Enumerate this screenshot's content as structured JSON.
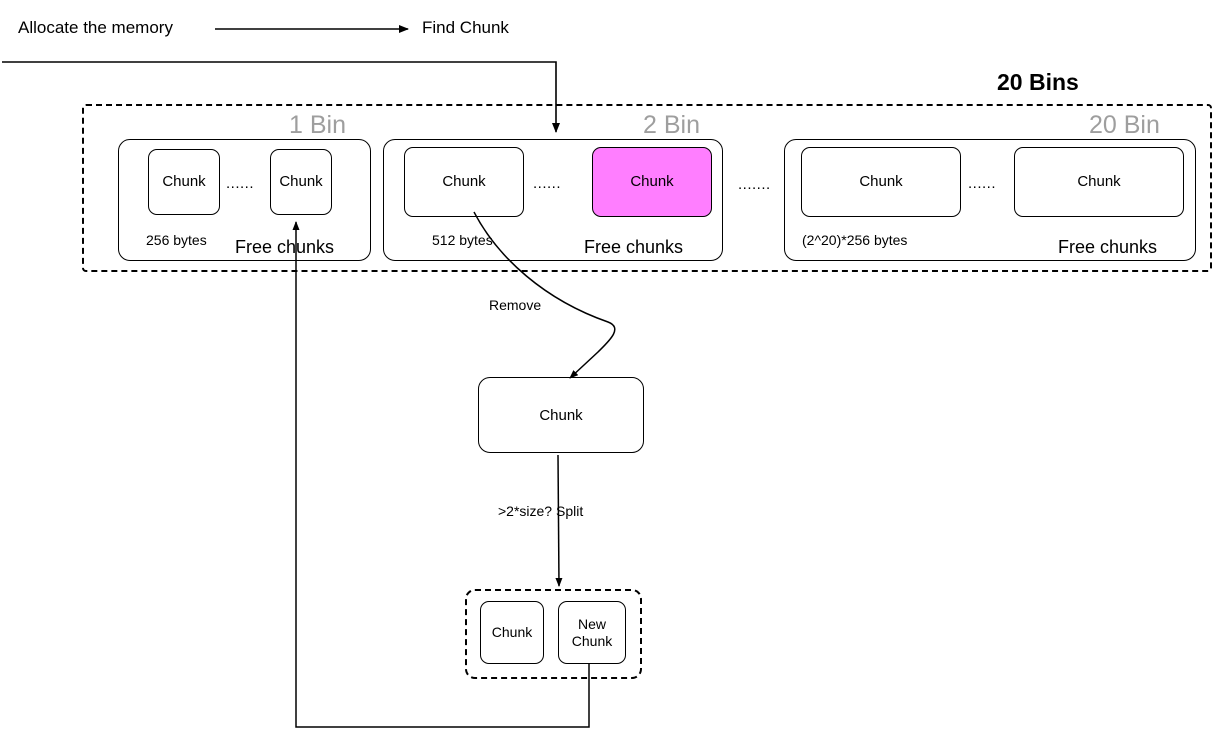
{
  "diagram": {
    "flow": {
      "allocate_label": "Allocate the memory",
      "find_chunk_label": "Find Chunk",
      "remove_label": "Remove",
      "split_label": ">2*size? Split"
    },
    "bins_container": {
      "title": "20 Bins",
      "bin_gap_ellipsis": ".......",
      "bins": [
        {
          "title": "1 Bin",
          "first_chunk": "Chunk",
          "ellipsis": "......",
          "last_chunk": "Chunk",
          "size_label": "256 bytes",
          "free_label": "Free chunks",
          "highlight": false,
          "highlight_color": ""
        },
        {
          "title": "2 Bin",
          "first_chunk": "Chunk",
          "ellipsis": "......",
          "last_chunk": "Chunk",
          "size_label": "512 bytes",
          "free_label": "Free chunks",
          "highlight": true,
          "highlight_color": "#FF7EFF"
        },
        {
          "title": "20 Bin",
          "first_chunk": "Chunk",
          "ellipsis": "......",
          "last_chunk": "Chunk",
          "size_label": "(2^20)*256 bytes",
          "free_label": "Free chunks",
          "highlight": false,
          "highlight_color": ""
        }
      ]
    },
    "removed_chunk": {
      "label": "Chunk"
    },
    "split_result": {
      "left_chunk": "Chunk",
      "right_chunk": "New\nChunk",
      "right_chunk_line1": "New",
      "right_chunk_line2": "Chunk"
    },
    "colors": {
      "stroke": "#000000",
      "bin_title": "#9e9e9e",
      "highlight": "#FF7EFF",
      "background": "#ffffff"
    }
  }
}
